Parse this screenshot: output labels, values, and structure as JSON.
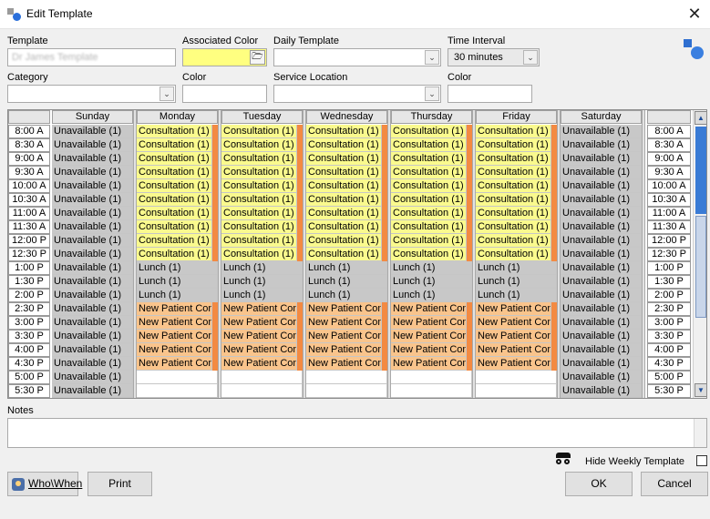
{
  "window": {
    "title": "Edit Template",
    "close_glyph": "✕"
  },
  "form": {
    "template_label": "Template",
    "template_value": "Dr James Template",
    "assoc_color_label": "Associated Color",
    "assoc_color_value": "#ffff80",
    "daily_template_label": "Daily Template",
    "daily_template_value": "",
    "time_interval_label": "Time Interval",
    "time_interval_value": "30 minutes",
    "category_label": "Category",
    "category_value": "",
    "color1_label": "Color",
    "service_location_label": "Service Location",
    "service_location_value": "",
    "color2_label": "Color"
  },
  "schedule": {
    "days": [
      "Sunday",
      "Monday",
      "Tuesday",
      "Wednesday",
      "Thursday",
      "Friday",
      "Saturday"
    ],
    "times": [
      "8:00 A",
      "8:30 A",
      "9:00 A",
      "9:30 A",
      "10:00 A",
      "10:30 A",
      "11:00 A",
      "11:30 A",
      "12:00 P",
      "12:30 P",
      "1:00 P",
      "1:30 P",
      "2:00 P",
      "2:30 P",
      "3:00 P",
      "3:30 P",
      "4:00 P",
      "4:30 P",
      "5:00 P",
      "5:30 P"
    ],
    "cell_labels": {
      "unavailable": "Unavailable (1)",
      "consultation": "Consultation (1)",
      "lunch": "Lunch (1)",
      "new_patient": "New Patient Cons"
    },
    "colors": {
      "unavailable": "#c8c8c8",
      "consultation": "#fafa8e",
      "lunch": "#c8c8c8",
      "new_patient": "#f9c48c",
      "stripe": "#f38a42"
    }
  },
  "notes": {
    "label": "Notes",
    "value": ""
  },
  "footer": {
    "hide_weekly_label": "Hide Weekly Template",
    "hide_weekly_checked": false,
    "who_when_label": "Who\\When",
    "print_label": "Print",
    "ok_label": "OK",
    "cancel_label": "Cancel"
  },
  "icons": {
    "app": "app-icon",
    "folder": "folder-icon",
    "corner": "template-icon",
    "spy": "spy-icon",
    "who_when": "user-icon"
  }
}
